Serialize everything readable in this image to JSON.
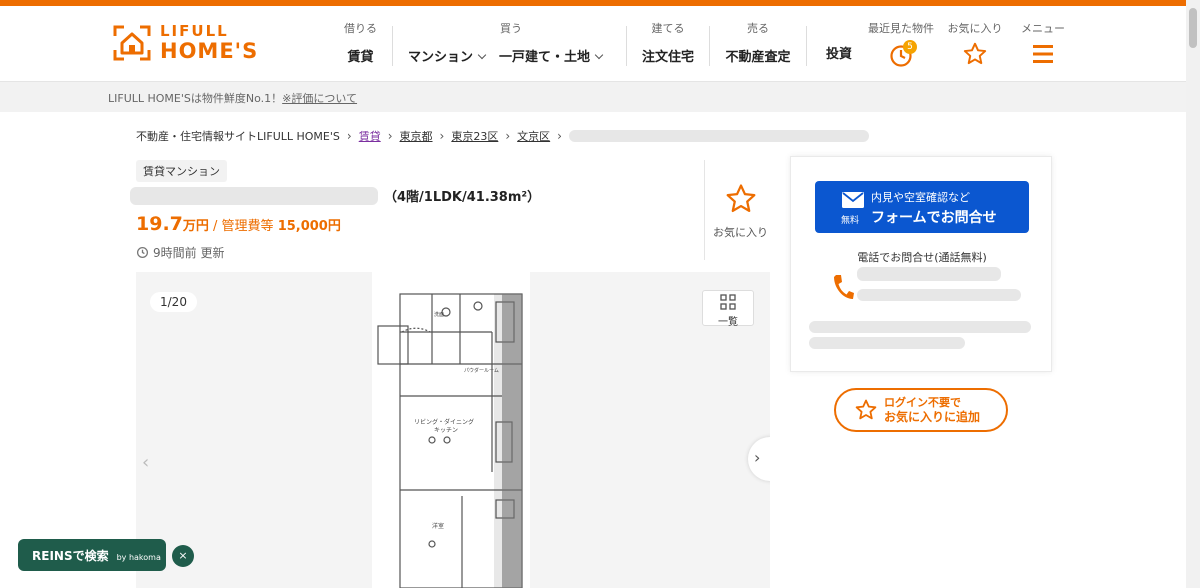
{
  "colors": {
    "brand": "#ed6d00",
    "form_button": "#0b57d0",
    "reins": "#1f5c4b"
  },
  "logo": {
    "line1": "LIFULL",
    "line2": "HOME'S"
  },
  "nav": {
    "rent": {
      "caption": "借りる",
      "label": "賃貸"
    },
    "buy": {
      "caption": "買う",
      "mansion": "マンション",
      "house": "一戸建て・土地"
    },
    "build": {
      "caption": "建てる",
      "label": "注文住宅"
    },
    "sell": {
      "caption": "売る",
      "label": "不動産査定"
    },
    "invest": {
      "label": "投資"
    },
    "recent": {
      "caption": "最近見た物件",
      "badge": "5",
      "icon": "clock-icon"
    },
    "favorites": {
      "caption": "お気に入り",
      "icon": "star-icon"
    },
    "menu": {
      "caption": "メニュー",
      "icon": "hamburger-icon"
    }
  },
  "notice": {
    "text": "LIFULL HOME'Sは物件鮮度No.1！",
    "link": "※評価について"
  },
  "breadcrumb": [
    "不動産・住宅情報サイトLIFULL HOME'S",
    "賃貸",
    "東京都",
    "東京23区",
    "文京区"
  ],
  "listing": {
    "tag": "賃貸マンション",
    "spec": "（4階/1LDK/41.38m²）",
    "rent_value": "19.7",
    "rent_unit": "万円",
    "fee_label": " / 管理費等 ",
    "fee_value": "15,000円",
    "updated": "9時間前 更新"
  },
  "favorite": {
    "label": "お気に入り"
  },
  "gallery": {
    "counter": "1/20",
    "list_label": "一覧"
  },
  "contact": {
    "form_small": "内見や空室確認など",
    "form_big": "フォームでお問合せ",
    "free": "無料",
    "phone_caption": "電話でお問合せ(通話無料)"
  },
  "login_fav": {
    "line1": "ログイン不要で",
    "line2": "お気に入りに追加"
  },
  "reins": {
    "label": "REINSで検索",
    "by": "by hakoma",
    "close": "×"
  }
}
